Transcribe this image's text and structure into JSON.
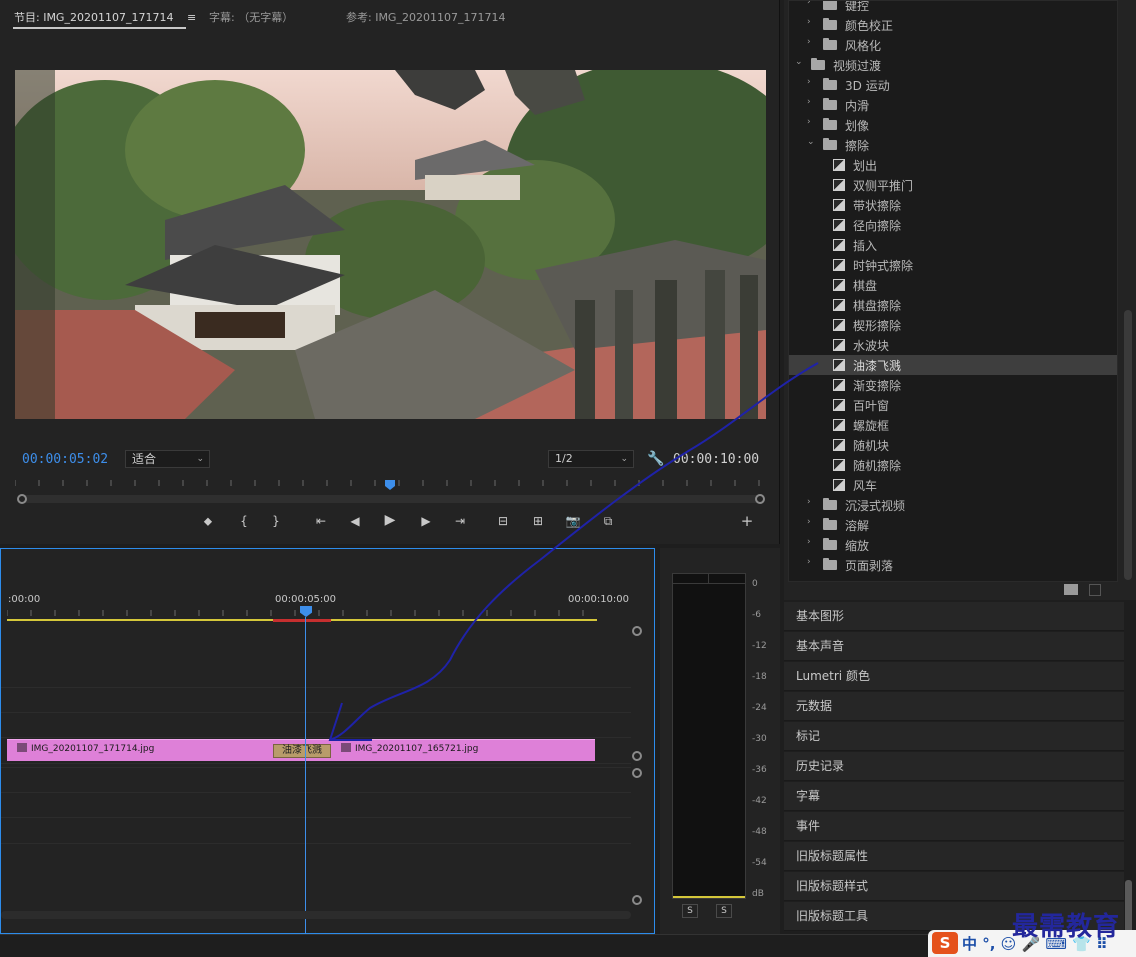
{
  "monitor": {
    "tabs": [
      {
        "label": "节目: IMG_20201107_171714",
        "menu": "≡"
      },
      {
        "label": "字幕: （无字幕）"
      },
      {
        "label": "参考: IMG_20201107_171714"
      }
    ],
    "current_time": "00:00:05:02",
    "fit": "适合",
    "resolution": "1/2",
    "duration": "00:00:10:00",
    "playhead_fraction": 0.5,
    "transport": {
      "marker": "⬥",
      "mark_in": "{",
      "mark_out": "}",
      "go_in": "⇤",
      "step_back": "◀",
      "play": "▶",
      "step_forward": "▶",
      "go_out": "⇥",
      "lift": "⊟",
      "extract": "⊞",
      "export_frame": "📷",
      "compare": "⧉",
      "add": "+"
    }
  },
  "timeline": {
    "ruler": {
      "start": ":00:00",
      "mid": "00:00:05:00",
      "end": "00:00:10:00"
    },
    "clip_a": "IMG_20201107_171714.jpg",
    "clip_b": "IMG_20201107_165721.jpg",
    "transition": "油漆飞溅"
  },
  "meters": {
    "db_scale": [
      "0",
      "-6",
      "-12",
      "-18",
      "-24",
      "-30",
      "-36",
      "-42",
      "-48",
      "-54",
      "dB"
    ],
    "solo_left": "S",
    "solo_right": "S"
  },
  "effects_tree": {
    "items": [
      {
        "label": "键控",
        "type": "folder",
        "level": 1,
        "expanded": false
      },
      {
        "label": "颜色校正",
        "type": "folder",
        "level": 1,
        "expanded": false
      },
      {
        "label": "风格化",
        "type": "folder",
        "level": 1,
        "expanded": false
      },
      {
        "label": "视频过渡",
        "type": "folder",
        "level": 0,
        "expanded": true
      },
      {
        "label": "3D 运动",
        "type": "folder",
        "level": 1,
        "expanded": false
      },
      {
        "label": "内滑",
        "type": "folder",
        "level": 1,
        "expanded": false
      },
      {
        "label": "划像",
        "type": "folder",
        "level": 1,
        "expanded": false
      },
      {
        "label": "擦除",
        "type": "folder",
        "level": 1,
        "expanded": true
      },
      {
        "label": "划出",
        "type": "effect",
        "level": 2
      },
      {
        "label": "双侧平推门",
        "type": "effect",
        "level": 2
      },
      {
        "label": "带状擦除",
        "type": "effect",
        "level": 2
      },
      {
        "label": "径向擦除",
        "type": "effect",
        "level": 2
      },
      {
        "label": "插入",
        "type": "effect",
        "level": 2
      },
      {
        "label": "时钟式擦除",
        "type": "effect",
        "level": 2
      },
      {
        "label": "棋盘",
        "type": "effect",
        "level": 2
      },
      {
        "label": "棋盘擦除",
        "type": "effect",
        "level": 2
      },
      {
        "label": "楔形擦除",
        "type": "effect",
        "level": 2
      },
      {
        "label": "水波块",
        "type": "effect",
        "level": 2
      },
      {
        "label": "油漆飞溅",
        "type": "effect",
        "level": 2,
        "selected": true
      },
      {
        "label": "渐变擦除",
        "type": "effect",
        "level": 2
      },
      {
        "label": "百叶窗",
        "type": "effect",
        "level": 2
      },
      {
        "label": "螺旋框",
        "type": "effect",
        "level": 2
      },
      {
        "label": "随机块",
        "type": "effect",
        "level": 2
      },
      {
        "label": "随机擦除",
        "type": "effect",
        "level": 2
      },
      {
        "label": "风车",
        "type": "effect",
        "level": 2
      },
      {
        "label": "沉浸式视频",
        "type": "folder",
        "level": 1,
        "expanded": false
      },
      {
        "label": "溶解",
        "type": "folder",
        "level": 1,
        "expanded": false
      },
      {
        "label": "缩放",
        "type": "folder",
        "level": 1,
        "expanded": false
      },
      {
        "label": "页面剥落",
        "type": "folder",
        "level": 1,
        "expanded": false
      }
    ]
  },
  "panels": [
    "基本图形",
    "基本声音",
    "Lumetri 颜色",
    "元数据",
    "标记",
    "历史记录",
    "字幕",
    "事件",
    "旧版标题属性",
    "旧版标题样式",
    "旧版标题工具"
  ],
  "ime": {
    "logo": "S",
    "text": "中 °, ☺ 🎤 ⌨ 👕 ⠿"
  },
  "watermark": "最需教育",
  "colors": {
    "accent_blue": "#3d8eea",
    "clip_pink": "#de80d8",
    "transition_tan": "#b89c6a",
    "annotation_stroke": "#1f22a8"
  }
}
